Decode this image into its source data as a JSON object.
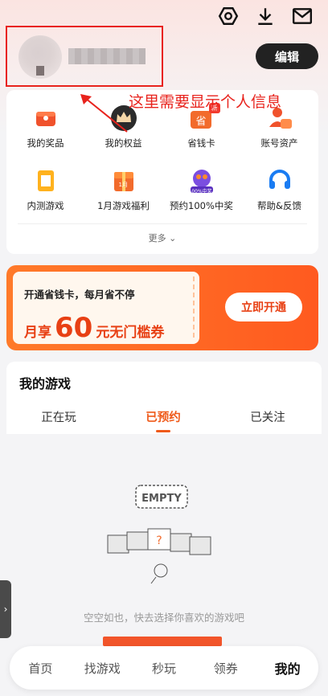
{
  "header": {
    "edit_label": "编辑",
    "icons": [
      "settings-icon",
      "download-icon",
      "mail-icon"
    ]
  },
  "annotation_text": "这里需要显示个人信息",
  "quick_grid": {
    "row1": [
      {
        "label": "我的奖品",
        "icon": "prize-box-icon"
      },
      {
        "label": "我的权益",
        "icon": "crown-icon"
      },
      {
        "label": "省钱卡",
        "icon": "savings-card-icon",
        "badge": "新"
      },
      {
        "label": "账号资产",
        "icon": "account-assets-icon"
      }
    ],
    "row2": [
      {
        "label": "内测游戏",
        "icon": "beta-game-icon"
      },
      {
        "label": "1月游戏福利",
        "icon": "gift-calendar-icon",
        "badge": "1月"
      },
      {
        "label": "预约100%中奖",
        "icon": "reservation-prize-icon",
        "badge": "100%中奖"
      },
      {
        "label": "帮助&反馈",
        "icon": "headset-icon"
      }
    ],
    "more_label": "更多"
  },
  "banner": {
    "line1": "开通省钱卡，每月省不停",
    "prefix": "月享",
    "amount": "60",
    "suffix": "元无门槛券",
    "button": "立即开通",
    "colors": {
      "accent": "#ff5a1f",
      "price": "#e84014"
    }
  },
  "my_games": {
    "title": "我的游戏",
    "tabs": [
      "正在玩",
      "已预约",
      "已关注"
    ],
    "active_tab": "已预约",
    "empty_badge": "EMPTY",
    "empty_text": "空空如也，快去选择你喜欢的游戏吧"
  },
  "bottom_nav": [
    "首页",
    "找游戏",
    "秒玩",
    "领券",
    "我的"
  ],
  "active_nav": "我的",
  "colors": {
    "highlight_box": "#e8231d",
    "active_tab": "#ef5a1a"
  }
}
